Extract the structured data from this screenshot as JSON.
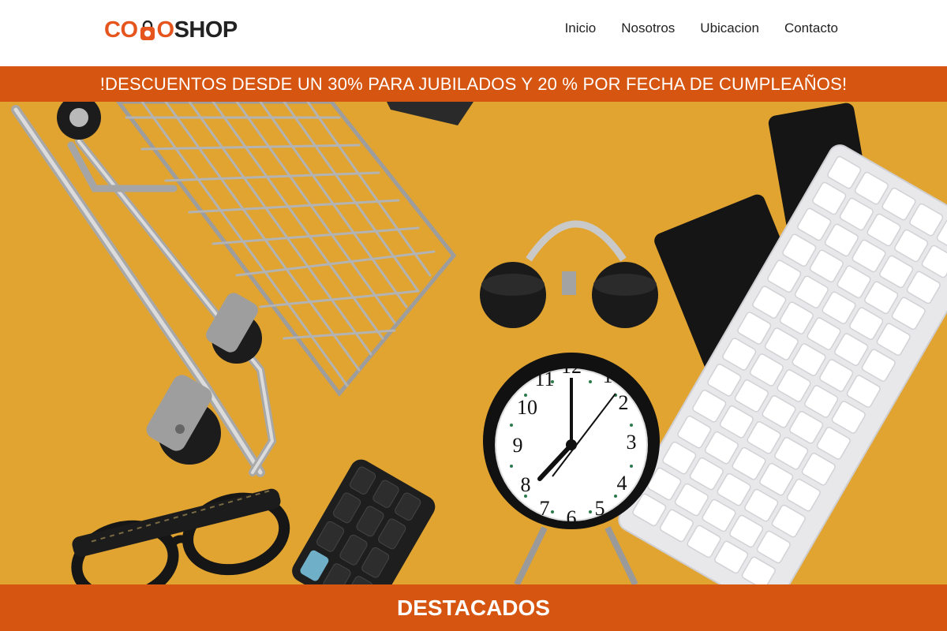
{
  "brand": {
    "logo_part1": "CO",
    "logo_part2": "O",
    "logo_part3": "SHOP",
    "accent_color": "#e5551d",
    "dark_color": "#222222"
  },
  "nav": {
    "items": [
      {
        "label": "Inicio"
      },
      {
        "label": "Nosotros"
      },
      {
        "label": "Ubicacion"
      },
      {
        "label": "Contacto"
      }
    ]
  },
  "promo": {
    "text": "!DESCUENTOS DESDE UN 30% PARA JUBILADOS Y 20 % POR FECHA DE CUMPLEAÑOS!",
    "background": "#d55511"
  },
  "hero": {
    "background": "#e3a633",
    "icons": [
      "shopping-cart-icon",
      "alarm-clock-icon",
      "calculator-icon",
      "glasses-icon",
      "keyboard-icon",
      "card-icon"
    ]
  },
  "section": {
    "title": "DESTACADOS",
    "background": "#d55511"
  }
}
